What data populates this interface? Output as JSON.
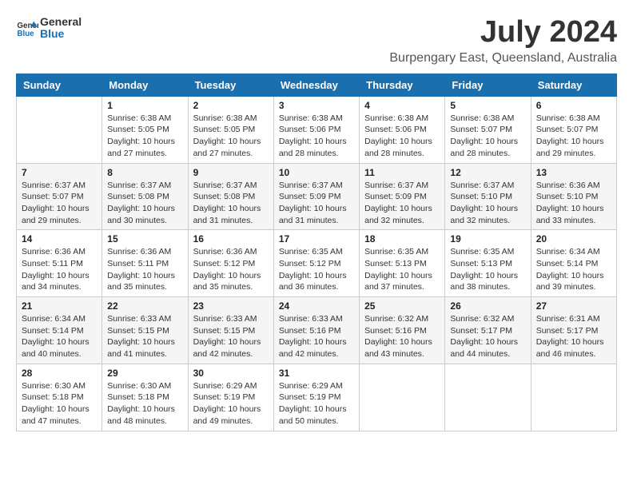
{
  "header": {
    "logo_line1": "General",
    "logo_line2": "Blue",
    "main_title": "July 2024",
    "subtitle": "Burpengary East, Queensland, Australia"
  },
  "calendar": {
    "days_of_week": [
      "Sunday",
      "Monday",
      "Tuesday",
      "Wednesday",
      "Thursday",
      "Friday",
      "Saturday"
    ],
    "weeks": [
      [
        {
          "day": "",
          "info": ""
        },
        {
          "day": "1",
          "info": "Sunrise: 6:38 AM\nSunset: 5:05 PM\nDaylight: 10 hours\nand 27 minutes."
        },
        {
          "day": "2",
          "info": "Sunrise: 6:38 AM\nSunset: 5:05 PM\nDaylight: 10 hours\nand 27 minutes."
        },
        {
          "day": "3",
          "info": "Sunrise: 6:38 AM\nSunset: 5:06 PM\nDaylight: 10 hours\nand 28 minutes."
        },
        {
          "day": "4",
          "info": "Sunrise: 6:38 AM\nSunset: 5:06 PM\nDaylight: 10 hours\nand 28 minutes."
        },
        {
          "day": "5",
          "info": "Sunrise: 6:38 AM\nSunset: 5:07 PM\nDaylight: 10 hours\nand 28 minutes."
        },
        {
          "day": "6",
          "info": "Sunrise: 6:38 AM\nSunset: 5:07 PM\nDaylight: 10 hours\nand 29 minutes."
        }
      ],
      [
        {
          "day": "7",
          "info": "Sunrise: 6:37 AM\nSunset: 5:07 PM\nDaylight: 10 hours\nand 29 minutes."
        },
        {
          "day": "8",
          "info": "Sunrise: 6:37 AM\nSunset: 5:08 PM\nDaylight: 10 hours\nand 30 minutes."
        },
        {
          "day": "9",
          "info": "Sunrise: 6:37 AM\nSunset: 5:08 PM\nDaylight: 10 hours\nand 31 minutes."
        },
        {
          "day": "10",
          "info": "Sunrise: 6:37 AM\nSunset: 5:09 PM\nDaylight: 10 hours\nand 31 minutes."
        },
        {
          "day": "11",
          "info": "Sunrise: 6:37 AM\nSunset: 5:09 PM\nDaylight: 10 hours\nand 32 minutes."
        },
        {
          "day": "12",
          "info": "Sunrise: 6:37 AM\nSunset: 5:10 PM\nDaylight: 10 hours\nand 32 minutes."
        },
        {
          "day": "13",
          "info": "Sunrise: 6:36 AM\nSunset: 5:10 PM\nDaylight: 10 hours\nand 33 minutes."
        }
      ],
      [
        {
          "day": "14",
          "info": "Sunrise: 6:36 AM\nSunset: 5:11 PM\nDaylight: 10 hours\nand 34 minutes."
        },
        {
          "day": "15",
          "info": "Sunrise: 6:36 AM\nSunset: 5:11 PM\nDaylight: 10 hours\nand 35 minutes."
        },
        {
          "day": "16",
          "info": "Sunrise: 6:36 AM\nSunset: 5:12 PM\nDaylight: 10 hours\nand 35 minutes."
        },
        {
          "day": "17",
          "info": "Sunrise: 6:35 AM\nSunset: 5:12 PM\nDaylight: 10 hours\nand 36 minutes."
        },
        {
          "day": "18",
          "info": "Sunrise: 6:35 AM\nSunset: 5:13 PM\nDaylight: 10 hours\nand 37 minutes."
        },
        {
          "day": "19",
          "info": "Sunrise: 6:35 AM\nSunset: 5:13 PM\nDaylight: 10 hours\nand 38 minutes."
        },
        {
          "day": "20",
          "info": "Sunrise: 6:34 AM\nSunset: 5:14 PM\nDaylight: 10 hours\nand 39 minutes."
        }
      ],
      [
        {
          "day": "21",
          "info": "Sunrise: 6:34 AM\nSunset: 5:14 PM\nDaylight: 10 hours\nand 40 minutes."
        },
        {
          "day": "22",
          "info": "Sunrise: 6:33 AM\nSunset: 5:15 PM\nDaylight: 10 hours\nand 41 minutes."
        },
        {
          "day": "23",
          "info": "Sunrise: 6:33 AM\nSunset: 5:15 PM\nDaylight: 10 hours\nand 42 minutes."
        },
        {
          "day": "24",
          "info": "Sunrise: 6:33 AM\nSunset: 5:16 PM\nDaylight: 10 hours\nand 42 minutes."
        },
        {
          "day": "25",
          "info": "Sunrise: 6:32 AM\nSunset: 5:16 PM\nDaylight: 10 hours\nand 43 minutes."
        },
        {
          "day": "26",
          "info": "Sunrise: 6:32 AM\nSunset: 5:17 PM\nDaylight: 10 hours\nand 44 minutes."
        },
        {
          "day": "27",
          "info": "Sunrise: 6:31 AM\nSunset: 5:17 PM\nDaylight: 10 hours\nand 46 minutes."
        }
      ],
      [
        {
          "day": "28",
          "info": "Sunrise: 6:30 AM\nSunset: 5:18 PM\nDaylight: 10 hours\nand 47 minutes."
        },
        {
          "day": "29",
          "info": "Sunrise: 6:30 AM\nSunset: 5:18 PM\nDaylight: 10 hours\nand 48 minutes."
        },
        {
          "day": "30",
          "info": "Sunrise: 6:29 AM\nSunset: 5:19 PM\nDaylight: 10 hours\nand 49 minutes."
        },
        {
          "day": "31",
          "info": "Sunrise: 6:29 AM\nSunset: 5:19 PM\nDaylight: 10 hours\nand 50 minutes."
        },
        {
          "day": "",
          "info": ""
        },
        {
          "day": "",
          "info": ""
        },
        {
          "day": "",
          "info": ""
        }
      ]
    ]
  }
}
